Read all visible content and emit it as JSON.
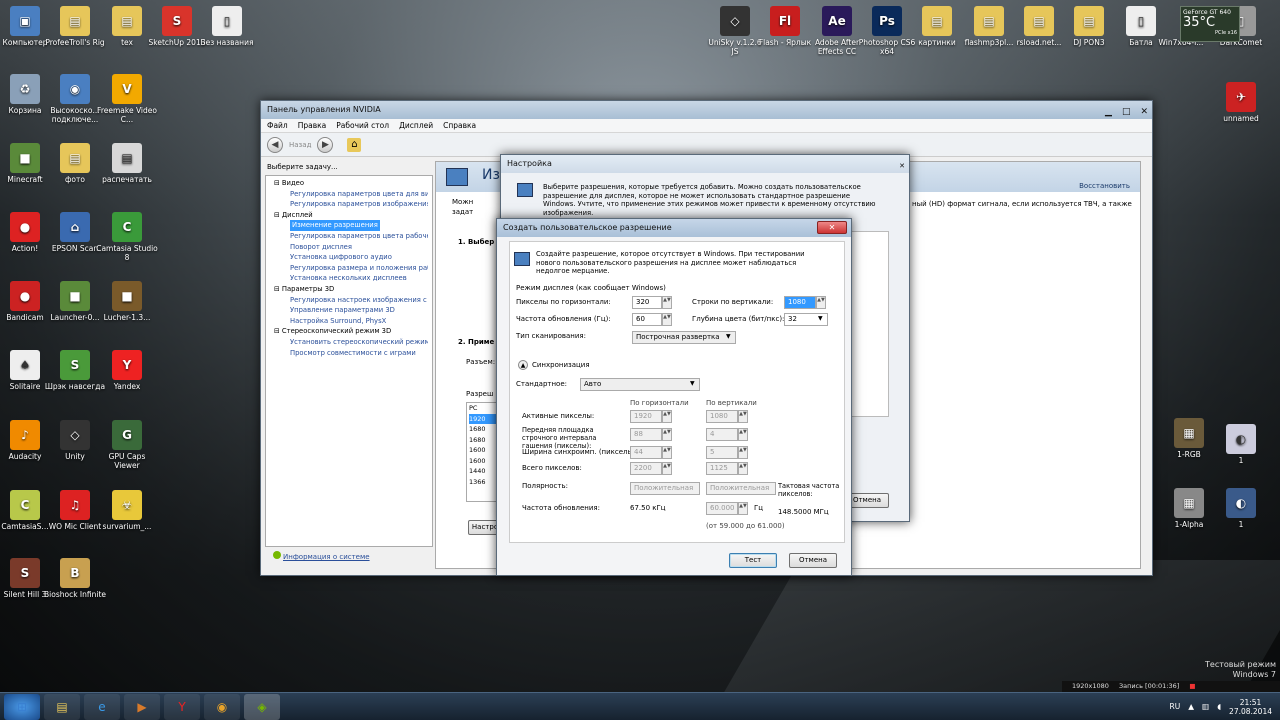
{
  "desktop_left": [
    {
      "label": "Компьютер",
      "icon": "computer-icon",
      "color": "#4a7fc1",
      "g": "▣"
    },
    {
      "label": "ProfeeTroll's Rig",
      "icon": "folder-icon",
      "color": "#e6c65a",
      "g": "▤"
    },
    {
      "label": "tex",
      "icon": "folder-icon",
      "color": "#e6c65a",
      "g": "▤"
    },
    {
      "label": "SketchUp 2013",
      "icon": "sketchup-icon",
      "color": "#d9342b",
      "g": "S"
    },
    {
      "label": "Без названия",
      "icon": "file-icon",
      "color": "#eeeeee",
      "g": "▯"
    },
    {
      "label": "Корзина",
      "icon": "recycle-bin-icon",
      "color": "#8aa0b8",
      "g": "♻"
    },
    {
      "label": "Высокоско... подключе...",
      "icon": "network-icon",
      "color": "#4a7fc1",
      "g": "◉"
    },
    {
      "label": "Freemake Video C...",
      "icon": "freemake-icon",
      "color": "#f2a900",
      "g": "V"
    },
    {
      "label": "Minecraft",
      "icon": "minecraft-icon",
      "color": "#5a8a3a",
      "g": "■"
    },
    {
      "label": "фото",
      "icon": "folder-icon",
      "color": "#e6c65a",
      "g": "▤"
    },
    {
      "label": "распечатать",
      "icon": "document-icon",
      "color": "#d8d8d8",
      "g": "▤"
    },
    {
      "label": "Action!",
      "icon": "action-icon",
      "color": "#d22",
      "g": "●"
    },
    {
      "label": "EPSON Scan",
      "icon": "scanner-icon",
      "color": "#3a6ab0",
      "g": "⌂"
    },
    {
      "label": "Camtasia Studio 8",
      "icon": "camtasia-icon",
      "color": "#3a9a3a",
      "g": "C"
    },
    {
      "label": "Bandicam",
      "icon": "bandicam-icon",
      "color": "#c22",
      "g": "●"
    },
    {
      "label": "Launcher-0...",
      "icon": "minecraft-icon",
      "color": "#5a8a3a",
      "g": "■"
    },
    {
      "label": "Lucher-1.3...",
      "icon": "minecraft-icon",
      "color": "#7a5a2a",
      "g": "■"
    },
    {
      "label": "Solitaire",
      "icon": "solitaire-icon",
      "color": "#eee",
      "g": "♠"
    },
    {
      "label": "Шрэк навсегда",
      "icon": "shrek-icon",
      "color": "#4a9a3a",
      "g": "S"
    },
    {
      "label": "Yandex",
      "icon": "yandex-icon",
      "color": "#e22",
      "g": "Y"
    },
    {
      "label": "Audacity",
      "icon": "audacity-icon",
      "color": "#f08a00",
      "g": "♪"
    },
    {
      "label": "Unity",
      "icon": "unity-icon",
      "color": "#333",
      "g": "◇"
    },
    {
      "label": "GPU Caps Viewer",
      "icon": "gpu-icon",
      "color": "#3a6a3a",
      "g": "G"
    },
    {
      "label": "CamtasiaS...",
      "icon": "camtasia-icon",
      "color": "#b8c84a",
      "g": "C"
    },
    {
      "label": "WO Mic Client",
      "icon": "microphone-icon",
      "color": "#d22",
      "g": "♫"
    },
    {
      "label": "survarium_...",
      "icon": "survarium-icon",
      "color": "#e8c83a",
      "g": "☣"
    },
    {
      "label": "Silent Hill 3",
      "icon": "silenthill-icon",
      "color": "#7a3a2a",
      "g": "S"
    },
    {
      "label": "Bioshock Infinite",
      "icon": "bioshock-icon",
      "color": "#c8a050",
      "g": "B"
    }
  ],
  "desktop_right": [
    {
      "label": "UniSky v.1.2.6 JS",
      "icon": "unity-icon",
      "color": "#333",
      "g": "◇"
    },
    {
      "label": "Flash - Ярлык",
      "icon": "flash-icon",
      "color": "#c81e1e",
      "g": "Fl"
    },
    {
      "label": "Adobe After Effects CC",
      "icon": "after-effects-icon",
      "color": "#2a1a5a",
      "g": "Ae"
    },
    {
      "label": "Photoshop CS6 x64",
      "icon": "photoshop-icon",
      "color": "#0a2a5a",
      "g": "Ps"
    },
    {
      "label": "картинки",
      "icon": "folder-icon",
      "color": "#e6c65a",
      "g": "▤"
    },
    {
      "label": "flashmp3pl...",
      "icon": "folder-icon",
      "color": "#e6c65a",
      "g": "▤"
    },
    {
      "label": "rsload.net...",
      "icon": "folder-icon",
      "color": "#e6c65a",
      "g": "▤"
    },
    {
      "label": "DJ PON3",
      "icon": "folder-icon",
      "color": "#e6c65a",
      "g": "▤"
    },
    {
      "label": "Батла",
      "icon": "file-icon",
      "color": "#eee",
      "g": "▯"
    },
    {
      "label": "Win7x64-I...",
      "icon": "folder-icon",
      "color": "#e6c65a",
      "g": "▤"
    },
    {
      "label": "DarkComet",
      "icon": "file-icon",
      "color": "#999",
      "g": "▯"
    }
  ],
  "side_right": [
    {
      "label": "unnamed",
      "icon": "unnamed-icon",
      "color": "#c22",
      "g": "✈"
    },
    {
      "label": "1-RGB",
      "icon": "image-icon",
      "color": "#6a5a3a",
      "g": "▦"
    },
    {
      "label": "1",
      "icon": "image-icon",
      "color": "#ccd",
      "g": "◐"
    },
    {
      "label": "1-Alpha",
      "icon": "image-icon",
      "color": "#888",
      "g": "▦"
    },
    {
      "label": "1",
      "icon": "image-icon",
      "color": "#3a5a8a",
      "g": "◐"
    }
  ],
  "gpu_widget": {
    "title": "GeForce GT 640",
    "temp": "35°C",
    "sub": "PCIe x16"
  },
  "nvidia": {
    "title": "Панель управления NVIDIA",
    "menu": [
      "Файл",
      "Правка",
      "Рабочий стол",
      "Дисплей",
      "Справка"
    ],
    "back_label": "Назад",
    "task_label": "Выберите задачу...",
    "tree": [
      {
        "t": "Видео",
        "lvl": 1
      },
      {
        "t": "Регулировка параметров цвета для вид",
        "lvl": 2
      },
      {
        "t": "Регулировка параметров изображения д",
        "lvl": 2
      },
      {
        "t": "Дисплей",
        "lvl": 1
      },
      {
        "t": "Изменение разрешения",
        "lvl": 2,
        "sel": true
      },
      {
        "t": "Регулировка параметров цвета рабочег",
        "lvl": 2
      },
      {
        "t": "Поворот дисплея",
        "lvl": 2
      },
      {
        "t": "Установка цифрового аудио",
        "lvl": 2
      },
      {
        "t": "Регулировка размера и положения рабо",
        "lvl": 2
      },
      {
        "t": "Установка нескольких дисплеев",
        "lvl": 2
      },
      {
        "t": "Параметры 3D",
        "lvl": 1
      },
      {
        "t": "Регулировка настроек изображения с пр",
        "lvl": 2
      },
      {
        "t": "Управление параметрами 3D",
        "lvl": 2
      },
      {
        "t": "Настройка Surround, PhysX",
        "lvl": 2
      },
      {
        "t": "Стереоскопический режим 3D",
        "lvl": 1
      },
      {
        "t": "Установить стереоскопический режим 3",
        "lvl": 2
      },
      {
        "t": "Просмотр совместимости с играми",
        "lvl": 2
      }
    ],
    "sysinfo": "Информация о системе",
    "heading": "Из",
    "restore": "Восстановить",
    "desc_frag": "Можн",
    "desc_frag2": "задат",
    "right_text1": "ный (HD) формат сигнала, если используется ТВЧ, а также",
    "step1": "1. Выбер",
    "step2": "2. Приме",
    "res_label": "Разреш",
    "size_label": "Разъем:",
    "list": [
      "PC",
      "1920",
      "1680",
      "1680",
      "1600",
      "1600",
      "1440",
      "1366"
    ],
    "settings_btn": "Настро"
  },
  "nastroika": {
    "title": "Настройка",
    "text": "Выберите разрешения, которые требуется добавить. Можно создать пользовательское разрешение для дисплея, которое не может использовать стандартное разрешение Windows. Учтите, что применение этих режимов может привести к временному отсутствию изображения.",
    "cancel_frag": "Отмена"
  },
  "custom": {
    "title": "Создать пользовательское разрешение",
    "intro": "Создайте разрешение, которое отсутствует в Windows. При тестировании нового пользовательского разрешения на дисплее может наблюдаться недолгое мерцание.",
    "mode_label": "Режим дисплея (как сообщает Windows)",
    "h_pixels_label": "Пикселы по горизонтали:",
    "h_pixels": "320",
    "rows_label": "Строки по вертикали:",
    "rows": "1080",
    "refresh_label": "Частота обновления (Гц):",
    "refresh": "60",
    "depth_label": "Глубина цвета (бит/пкс):",
    "depth": "32",
    "scan_label": "Тип сканирования:",
    "scan": "Построчная развертка",
    "sync_label": "Синхронизация",
    "std_label": "Стандартное:",
    "std": "Авто",
    "col_h": "По горизонтали",
    "col_v": "По вертикали",
    "active_label": "Активные пикселы:",
    "active_h": "1920",
    "active_v": "1080",
    "front_label": "Передняя площадка строчного интервала гашения (пикселы):",
    "front_h": "88",
    "front_v": "4",
    "width_label": "Ширина синхроимп. (пикселы):",
    "width_h": "44",
    "width_v": "5",
    "total_label": "Всего пикселов:",
    "total_h": "2200",
    "total_v": "1125",
    "polarity_label": "Полярность:",
    "pol_h": "Положительная",
    "pol_v": "Положительная",
    "freq_label": "Частота обновления:",
    "freq_h": "67.50 кГц",
    "freq_v": "60.000",
    "hz": "Гц",
    "range": "(от 59.000 до 61.000)",
    "pixclock_label": "Тактовая частота пикселов:",
    "pixclock": "148.5000 МГц",
    "test": "Тест",
    "cancel": "Отмена"
  },
  "watermark": {
    "l1": "Тестовый режим",
    "l2": "Windows 7"
  },
  "tray": {
    "res": "1920x1080",
    "rec": "Запись [00:01:36]",
    "lang": "RU",
    "time": "21:51",
    "date": "27.08.2014"
  },
  "taskbar_items": [
    {
      "icon": "start-icon",
      "g": "⊞",
      "color": "#3a7fd0"
    },
    {
      "icon": "explorer-icon",
      "g": "▤",
      "color": "#e6c65a"
    },
    {
      "icon": "ie-icon",
      "g": "e",
      "color": "#3a9ae8"
    },
    {
      "icon": "media-player-icon",
      "g": "▶",
      "color": "#d87a2a"
    },
    {
      "icon": "yandex-icon",
      "g": "Y",
      "color": "#e22"
    },
    {
      "icon": "chrome-icon",
      "g": "◉",
      "color": "#e8a32a"
    },
    {
      "icon": "nvidia-icon",
      "g": "◈",
      "color": "#76b900"
    }
  ]
}
